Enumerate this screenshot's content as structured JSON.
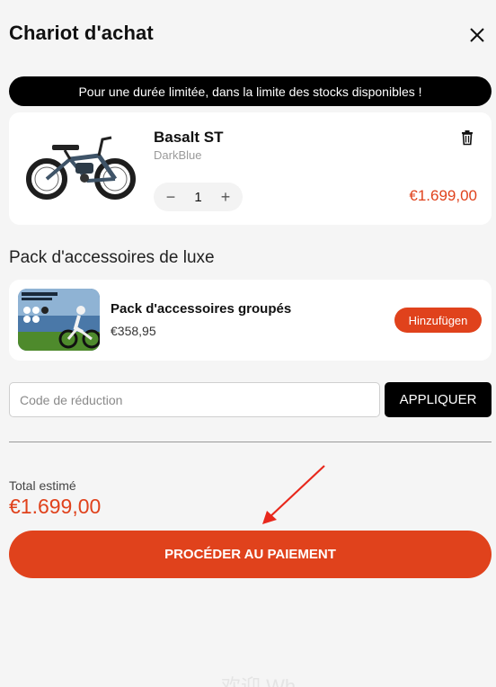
{
  "header": {
    "title": "Chariot d'achat",
    "close_icon": "close-icon"
  },
  "promo": {
    "text": "Pour une durée limitée, dans la limite des stocks disponibles !"
  },
  "cart_item": {
    "name": "Basalt ST",
    "variant": "DarkBlue",
    "quantity": "1",
    "price": "€1.699,00",
    "image_icon": "e-bike-image",
    "delete_icon": "trash-icon"
  },
  "bundle_section": {
    "title": "Pack d'accessoires de luxe"
  },
  "bundle": {
    "name": "Pack d'accessoires groupés",
    "price": "€358,95",
    "add_label": "Hinzufügen",
    "image_icon": "accessory-bundle-image"
  },
  "discount": {
    "placeholder": "Code de réduction",
    "apply_label": "APPLIQUER"
  },
  "total": {
    "label": "Total estimé",
    "value": "€1.699,00"
  },
  "checkout": {
    "label": "PROCÉDER AU PAIEMENT"
  },
  "footer": {
    "faint_text": "欢迎 Wh"
  },
  "colors": {
    "accent": "#e0421c",
    "promo_bg": "#000000",
    "annotation_arrow": "#e8281c"
  }
}
